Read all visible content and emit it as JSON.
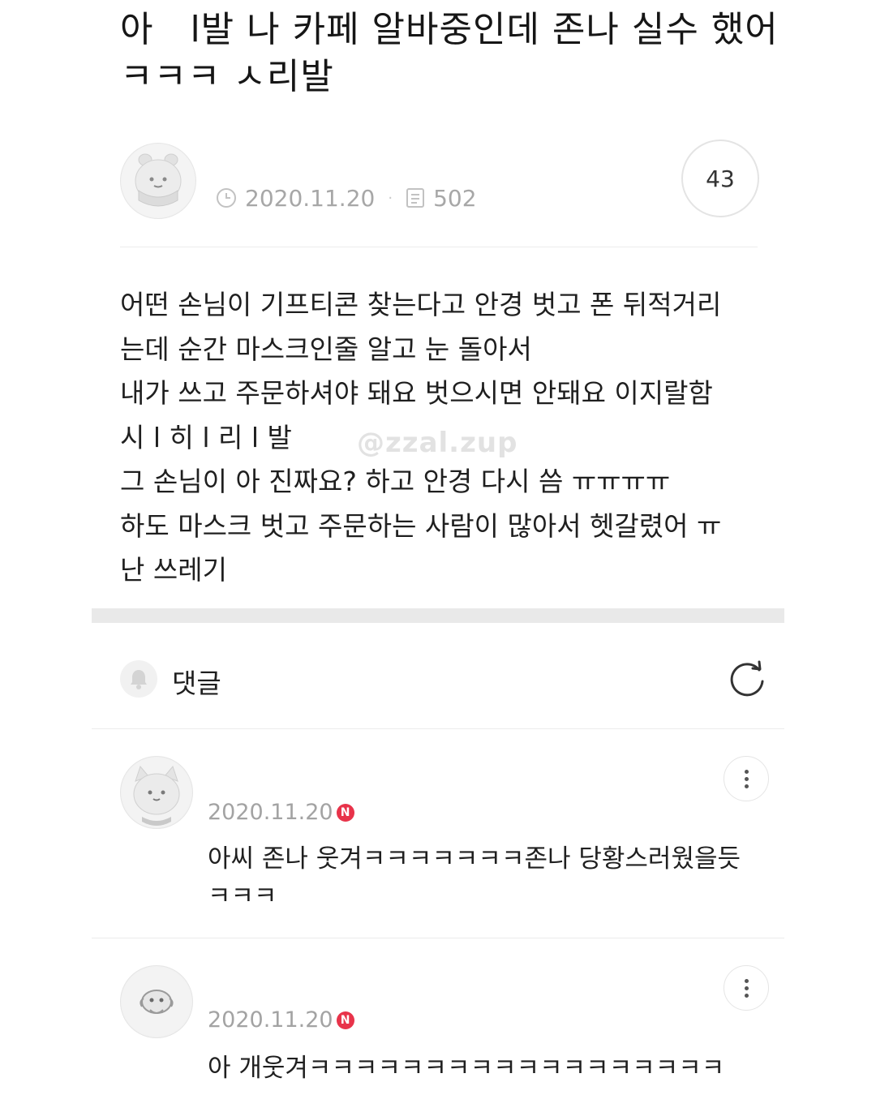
{
  "post": {
    "title": "아   l발 나 카페 알바중인데 존나 실수 했어 ㅋㅋㅋ ㅅ리발",
    "date": "2020.11.20",
    "views": "502",
    "comment_count": "43",
    "body_lines": [
      "어떤 손님이 기프티콘 찾는다고 안경 벗고 폰 뒤적거리",
      "는데 순간 마스크인줄 알고 눈 돌아서",
      "내가 쓰고 주문하셔야 돼요 벗으시면 안돼요 이지랄함",
      "시 l 히 l 리 l 발",
      "그 손님이 아 진짜요? 하고 안경 다시 씀 ㅠㅠㅠㅠ",
      "하도 마스크 벗고 주문하는 사람이 많아서 헷갈렸어 ㅠ",
      "난 쓰레기"
    ],
    "watermark": "@zzal.zup"
  },
  "comments_section": {
    "label": "댓글"
  },
  "comments": [
    {
      "date": "2020.11.20",
      "badge": "N",
      "text": "아씨 존나 웃겨ㅋㅋㅋㅋㅋㅋㅋ존나 당황스러웠을듯 ㅋㅋㅋ"
    },
    {
      "date": "2020.11.20",
      "badge": "N",
      "text": "아 개웃겨ㅋㅋㅋㅋㅋㅋㅋㅋㅋㅋㅋㅋㅋㅋㅋㅋㅋㅋ"
    }
  ],
  "colors": {
    "badge": "#e8334a",
    "meta_text": "#a7a7a7",
    "divider": "#ececec"
  },
  "icons": {
    "clock": "clock-icon",
    "views": "document-icon",
    "bell": "bell-icon",
    "refresh": "refresh-icon",
    "more": "more-vertical-icon"
  }
}
